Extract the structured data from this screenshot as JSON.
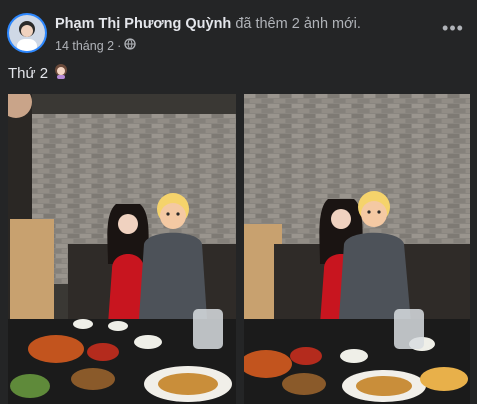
{
  "post": {
    "author": "Phạm Thị Phương Quỳnh",
    "action": "đã thêm 2 ảnh mới.",
    "date": "14 tháng 2",
    "separator": "·",
    "privacy_icon": "globe-icon",
    "more_icon": "more-options-icon",
    "caption": "Thứ 2",
    "caption_emoji": "woman-emoji-icon"
  },
  "photos": [
    {
      "id": "photo-1",
      "description_icon": "restaurant-photo"
    },
    {
      "id": "photo-2",
      "description_icon": "restaurant-photo"
    }
  ],
  "colors": {
    "background": "#242526",
    "text_primary": "#e4e6eb",
    "text_secondary": "#b0b3b8",
    "accent": "#2d88ff"
  }
}
